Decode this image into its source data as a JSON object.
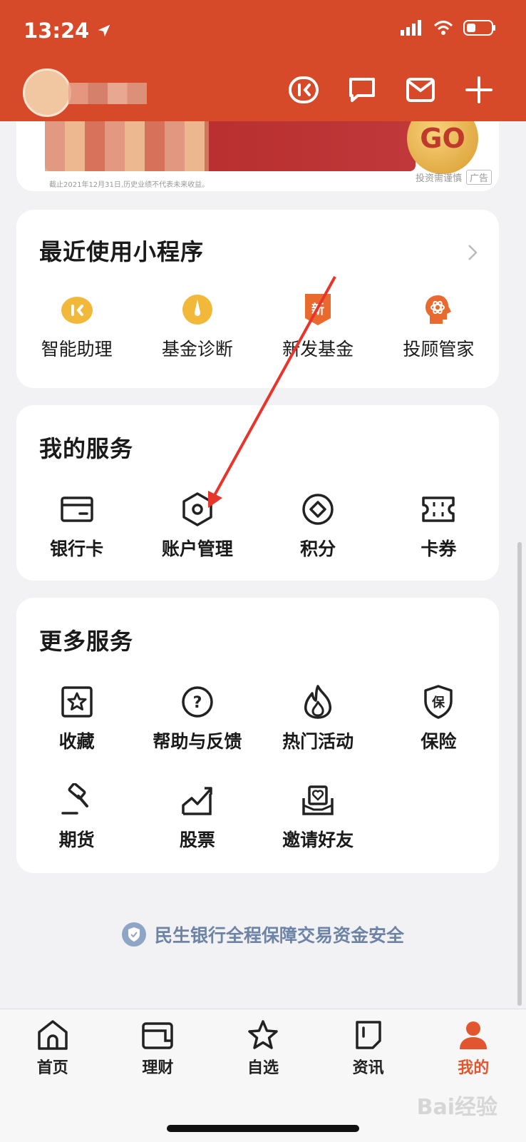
{
  "status": {
    "time": "13:24"
  },
  "banner": {
    "badge": "GO",
    "note": "投资需谨慎",
    "ad": "广告",
    "fine_print": "截止2021年12月31日,历史业绩不代表未来收益。"
  },
  "recent": {
    "title": "最近使用小程序",
    "items": [
      {
        "label": "智能助理",
        "icon": "assistant-icon"
      },
      {
        "label": "基金诊断",
        "icon": "fund-diagnosis-icon"
      },
      {
        "label": "新发基金",
        "icon": "new-fund-icon",
        "badge_text": "新"
      },
      {
        "label": "投顾管家",
        "icon": "advisor-icon"
      }
    ]
  },
  "my_services": {
    "title": "我的服务",
    "items": [
      {
        "label": "银行卡",
        "icon": "bank-card-icon"
      },
      {
        "label": "账户管理",
        "icon": "account-settings-icon"
      },
      {
        "label": "积分",
        "icon": "points-icon"
      },
      {
        "label": "卡券",
        "icon": "coupon-icon"
      }
    ]
  },
  "more_services": {
    "title": "更多服务",
    "items": [
      {
        "label": "收藏",
        "icon": "favorite-icon"
      },
      {
        "label": "帮助与反馈",
        "icon": "help-icon",
        "icon_text": "?"
      },
      {
        "label": "热门活动",
        "icon": "fire-icon"
      },
      {
        "label": "保险",
        "icon": "insurance-icon",
        "icon_text": "保"
      },
      {
        "label": "期货",
        "icon": "futures-icon"
      },
      {
        "label": "股票",
        "icon": "stock-icon"
      },
      {
        "label": "邀请好友",
        "icon": "invite-icon"
      }
    ]
  },
  "security_notice": "民生银行全程保障交易资金安全",
  "tabbar": [
    {
      "label": "首页",
      "icon": "home-icon"
    },
    {
      "label": "理财",
      "icon": "wallet-icon"
    },
    {
      "label": "自选",
      "icon": "star-icon"
    },
    {
      "label": "资讯",
      "icon": "news-icon"
    },
    {
      "label": "我的",
      "icon": "profile-icon",
      "active": true
    }
  ],
  "watermark": "Bai经验",
  "colors": {
    "header": "#d64a2a",
    "accent": "#e2562f",
    "icon_yellow": "#f1b83a"
  }
}
